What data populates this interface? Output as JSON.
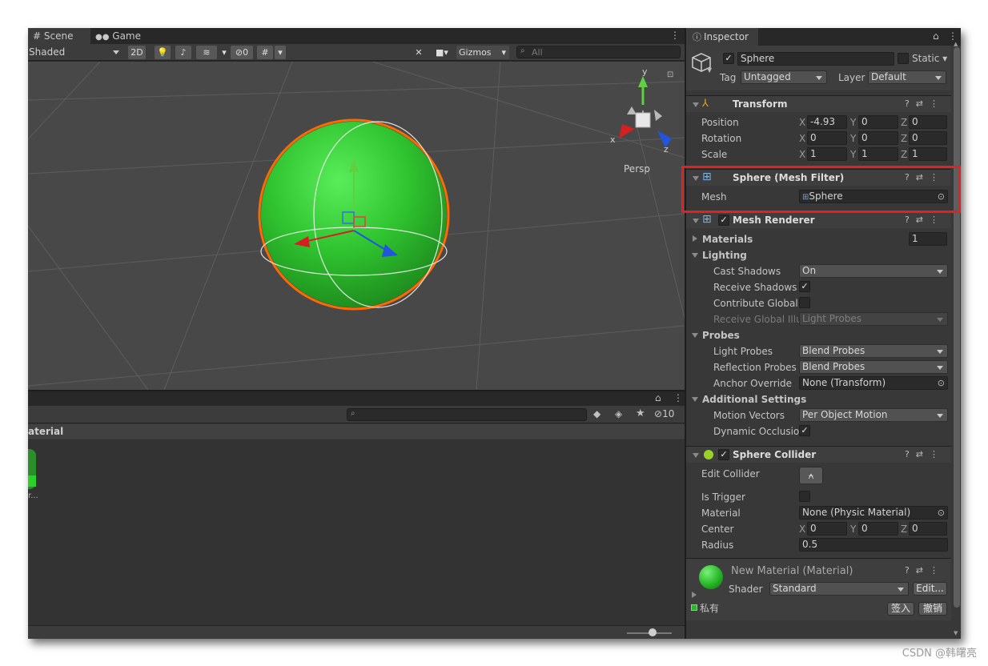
{
  "scene_tabs": {
    "scene": "Scene",
    "game": "Game"
  },
  "scene_toolbar": {
    "shading": "Shaded",
    "mode_2d": "2D",
    "hidden_count": "0",
    "gizmos": "Gizmos",
    "search_placeholder": "All"
  },
  "viewport": {
    "persp_label": "Persp",
    "gizmo_axes": {
      "x": "x",
      "y": "y",
      "z": "z"
    },
    "colors": {
      "sphere": "#33cc33",
      "outline": "#ff6a00",
      "x_axis": "#d42020",
      "y_axis": "#5fd040",
      "z_axis": "#2255dd"
    }
  },
  "project": {
    "lock_icon": "lock-icon",
    "hidden_count": "10",
    "breadcrumb": "aterial",
    "asset_caption": "r..."
  },
  "inspector": {
    "tab_label": "Inspector",
    "object": {
      "name": "Sphere",
      "static_label": "Static",
      "tag_label": "Tag",
      "tag_value": "Untagged",
      "layer_label": "Layer",
      "layer_value": "Default"
    },
    "transform": {
      "title": "Transform",
      "rows": [
        {
          "label": "Position",
          "x": "-4.93",
          "y": "0",
          "z": "0"
        },
        {
          "label": "Rotation",
          "x": "0",
          "y": "0",
          "z": "0"
        },
        {
          "label": "Scale",
          "x": "1",
          "y": "1",
          "z": "1"
        }
      ],
      "axis_x": "X",
      "axis_y": "Y",
      "axis_z": "Z"
    },
    "mesh_filter": {
      "title": "Sphere (Mesh Filter)",
      "mesh_label": "Mesh",
      "mesh_value": "Sphere"
    },
    "mesh_renderer": {
      "title": "Mesh Renderer",
      "materials_label": "Materials",
      "materials_count": "1",
      "lighting_label": "Lighting",
      "cast_shadows_label": "Cast Shadows",
      "cast_shadows_value": "On",
      "receive_shadows_label": "Receive Shadows",
      "contribute_gi_label": "Contribute Global I",
      "receive_gi_label": "Receive Global Illu",
      "receive_gi_value": "Light Probes",
      "probes_label": "Probes",
      "light_probes_label": "Light Probes",
      "light_probes_value": "Blend Probes",
      "reflection_probes_label": "Reflection Probes",
      "reflection_probes_value": "Blend Probes",
      "anchor_override_label": "Anchor Override",
      "anchor_override_value": "None (Transform)",
      "additional_settings_label": "Additional Settings",
      "motion_vectors_label": "Motion Vectors",
      "motion_vectors_value": "Per Object Motion",
      "dynamic_occlusion_label": "Dynamic Occlusioi"
    },
    "sphere_collider": {
      "title": "Sphere Collider",
      "edit_collider_label": "Edit Collider",
      "is_trigger_label": "Is Trigger",
      "material_label": "Material",
      "material_value": "None (Physic Material)",
      "center_label": "Center",
      "center": {
        "x": "0",
        "y": "0",
        "z": "0"
      },
      "radius_label": "Radius",
      "radius_value": "0.5"
    },
    "material": {
      "title": "New Material (Material)",
      "shader_label": "Shader",
      "shader_value": "Standard",
      "edit_button": "Edit...",
      "private_label": "私有",
      "checkin_button": "签入",
      "undo_button": "撤销"
    }
  },
  "watermark": "CSDN @韩曙亮"
}
